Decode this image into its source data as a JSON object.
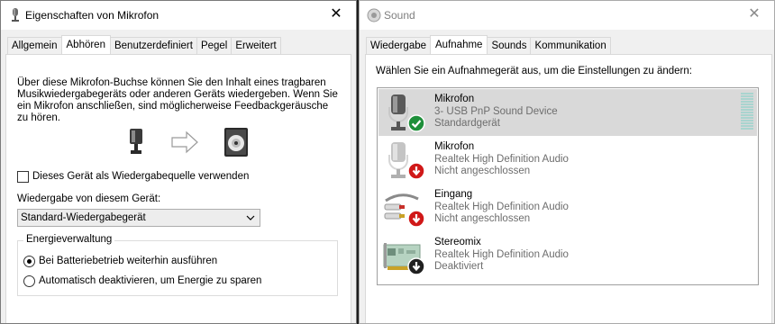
{
  "left_window": {
    "title": "Eigenschaften von Mikrofon",
    "close": "✕",
    "tabs": [
      {
        "label": "Allgemein",
        "active": false
      },
      {
        "label": "Abhören",
        "active": true
      },
      {
        "label": "Benutzerdefiniert",
        "active": false
      },
      {
        "label": "Pegel",
        "active": false
      },
      {
        "label": "Erweitert",
        "active": false
      }
    ],
    "description": "Über diese Mikrofon-Buchse können Sie den Inhalt eines tragbaren Musikwiedergabegeräts oder anderen Geräts wiedergeben. Wenn Sie ein Mikrofon anschließen, sind möglicherweise Feedbackgeräusche zu hören.",
    "listen_checkbox": {
      "label": "Dieses Gerät als Wiedergabequelle verwenden",
      "checked": false
    },
    "playback_label": "Wiedergabe von diesem Gerät:",
    "playback_select": "Standard-Wiedergabegerät",
    "power_group": {
      "title": "Energieverwaltung",
      "options": [
        {
          "label": "Bei Batteriebetrieb weiterhin ausführen",
          "checked": true
        },
        {
          "label": "Automatisch deaktivieren, um Energie zu sparen",
          "checked": false
        }
      ]
    }
  },
  "right_window": {
    "title": "Sound",
    "close": "✕",
    "tabs": [
      {
        "label": "Wiedergabe",
        "active": false
      },
      {
        "label": "Aufnahme",
        "active": true
      },
      {
        "label": "Sounds",
        "active": false
      },
      {
        "label": "Kommunikation",
        "active": false
      }
    ],
    "instruction": "Wählen Sie ein Aufnahmegerät aus, um die Einstellungen zu ändern:",
    "devices": [
      {
        "name": "Mikrofon",
        "driver": "3- USB PnP Sound Device",
        "status": "Standardgerät",
        "icon": "microphone-icon",
        "badge": "check-badge-icon",
        "selected": true
      },
      {
        "name": "Mikrofon",
        "driver": "Realtek High Definition Audio",
        "status": "Nicht angeschlossen",
        "icon": "microphone-icon",
        "badge": "red-down-arrow-badge-icon",
        "selected": false
      },
      {
        "name": "Eingang",
        "driver": "Realtek High Definition Audio",
        "status": "Nicht angeschlossen",
        "icon": "line-in-cable-icon",
        "badge": "red-down-arrow-badge-icon",
        "selected": false
      },
      {
        "name": "Stereomix",
        "driver": "Realtek High Definition Audio",
        "status": "Deaktiviert",
        "icon": "sound-card-icon",
        "badge": "black-down-arrow-badge-icon",
        "selected": false
      }
    ]
  },
  "colors": {
    "selected_row": "#d9d9d9",
    "check_badge": "#1e8f3a",
    "error_badge": "#d01818",
    "disabled_badge": "#202020",
    "meter_bar": "#a9d4cf"
  }
}
